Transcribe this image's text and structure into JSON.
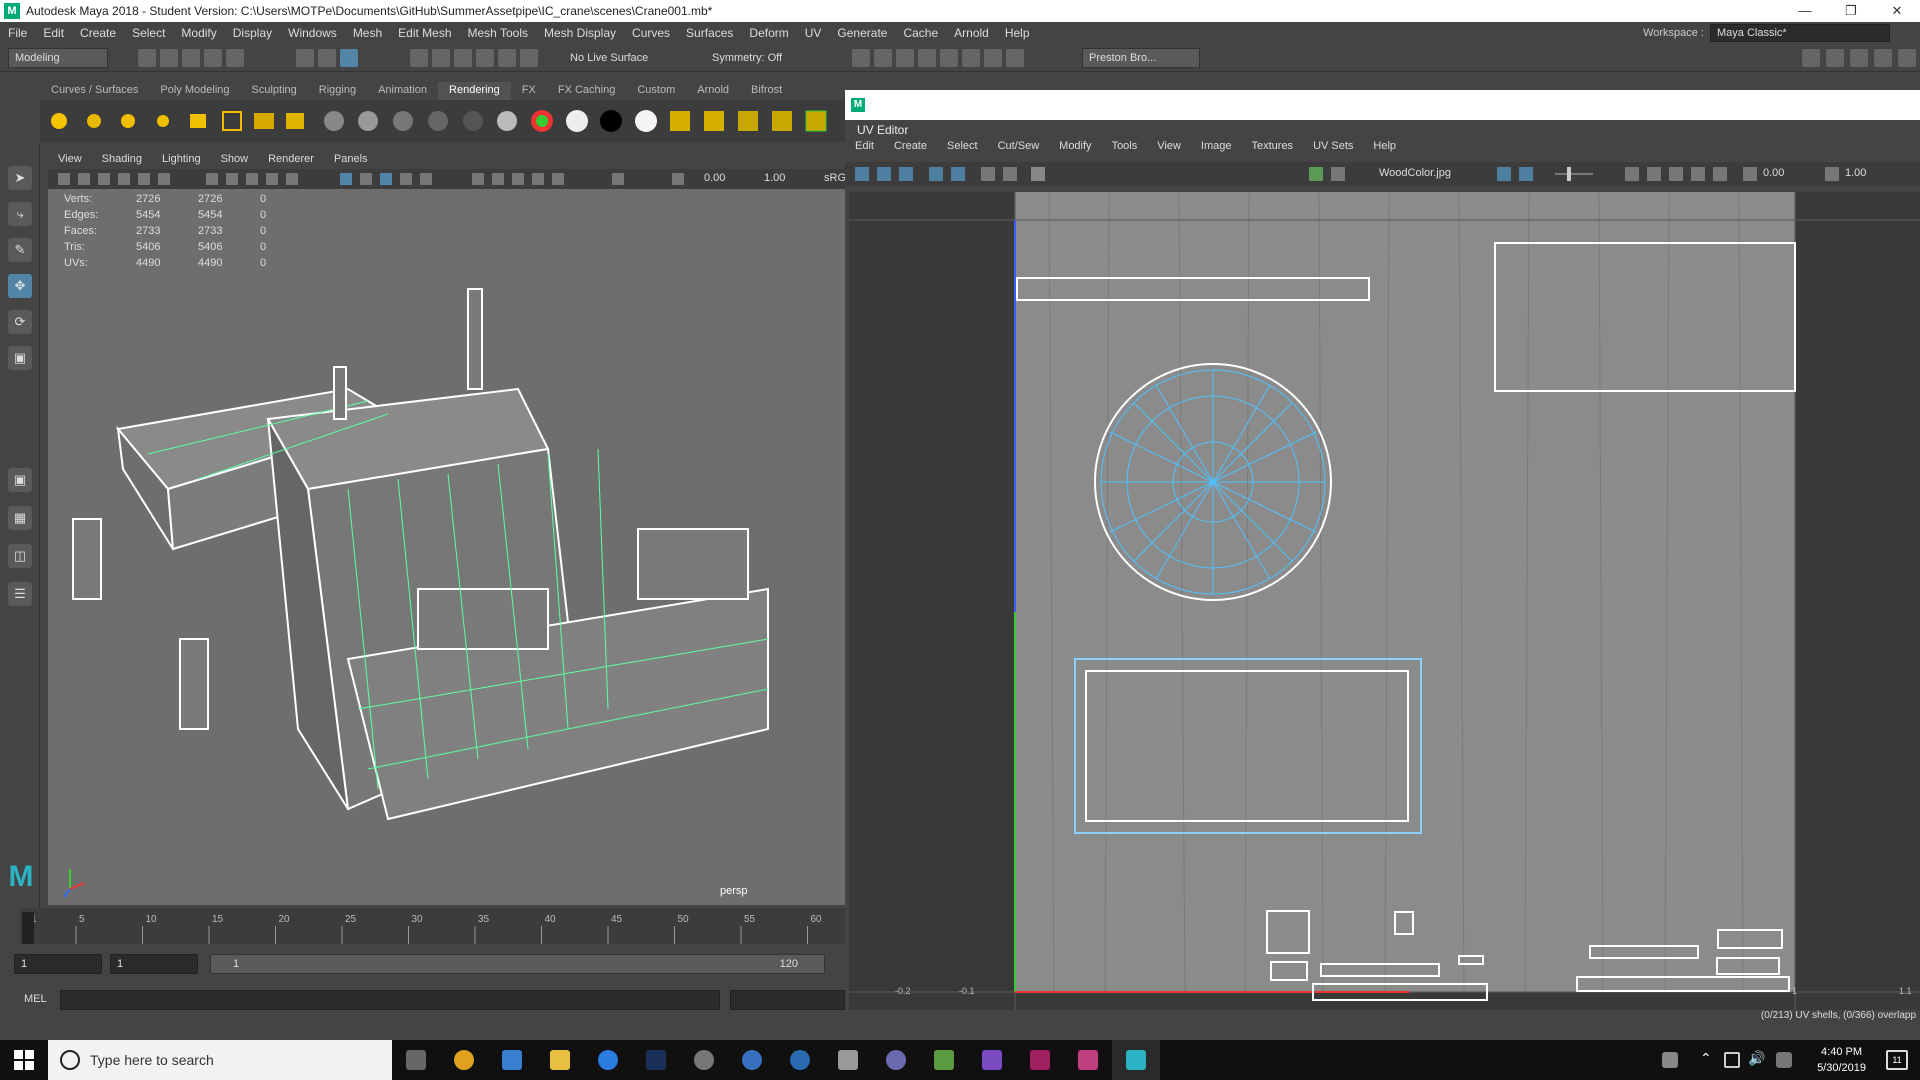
{
  "window": {
    "title": "Autodesk Maya 2018 - Student Version: C:\\Users\\MOTPe\\Documents\\GitHub\\SummerAssetpipe\\IC_crane\\scenes\\Crane001.mb*"
  },
  "menubar": {
    "items": [
      "File",
      "Edit",
      "Create",
      "Select",
      "Modify",
      "Display",
      "Windows",
      "Mesh",
      "Edit Mesh",
      "Mesh Tools",
      "Mesh Display",
      "Curves",
      "Surfaces",
      "Deform",
      "UV",
      "Generate",
      "Cache",
      "Arnold",
      "Help"
    ],
    "workspace_label": "Workspace :",
    "workspace_value": "Maya Classic*"
  },
  "statusline": {
    "mode": "Modeling",
    "live_surface": "No Live Surface",
    "symmetry": "Symmetry: Off",
    "user": "Preston Bro..."
  },
  "shelf": {
    "tabs": [
      "Curves / Surfaces",
      "Poly Modeling",
      "Sculpting",
      "Rigging",
      "Animation",
      "Rendering",
      "FX",
      "FX Caching",
      "Custom",
      "Arnold",
      "Bifrost"
    ],
    "active_tab": "Rendering"
  },
  "viewport": {
    "menu": [
      "View",
      "Shading",
      "Lighting",
      "Show",
      "Renderer",
      "Panels"
    ],
    "field_a": "0.00",
    "field_b": "1.00",
    "color_space": "sRG",
    "hud": [
      {
        "label": "Verts:",
        "a": "2726",
        "b": "2726",
        "c": "0"
      },
      {
        "label": "Edges:",
        "a": "5454",
        "b": "5454",
        "c": "0"
      },
      {
        "label": "Faces:",
        "a": "2733",
        "b": "2733",
        "c": "0"
      },
      {
        "label": "Tris:",
        "a": "5406",
        "b": "5406",
        "c": "0"
      },
      {
        "label": "UVs:",
        "a": "4490",
        "b": "4490",
        "c": "0"
      }
    ],
    "camera": "persp"
  },
  "timeline": {
    "ticks": [
      "1",
      "5",
      "10",
      "15",
      "20",
      "25",
      "30",
      "35",
      "40",
      "45",
      "50",
      "55",
      "60"
    ],
    "range_start": "1",
    "range_inner_start": "1",
    "slider_start": "1",
    "slider_end": "120",
    "cmd_label": "MEL"
  },
  "uv_editor": {
    "title": "UV Editor",
    "menu": [
      "Edit",
      "Create",
      "Select",
      "Cut/Sew",
      "Modify",
      "Tools",
      "View",
      "Image",
      "Textures",
      "UV Sets",
      "Help"
    ],
    "texture": "WoodColor.jpg",
    "field_a": "0.00",
    "field_b": "1.00",
    "axis_labels": [
      "-0.2",
      "-0.1",
      "1",
      "1.1"
    ],
    "status": "(0/213) UV shells, (0/366) overlapp"
  },
  "taskbar": {
    "search_placeholder": "Type here to search",
    "time": "4:40 PM",
    "date": "5/30/2019",
    "notification_count": "11"
  }
}
